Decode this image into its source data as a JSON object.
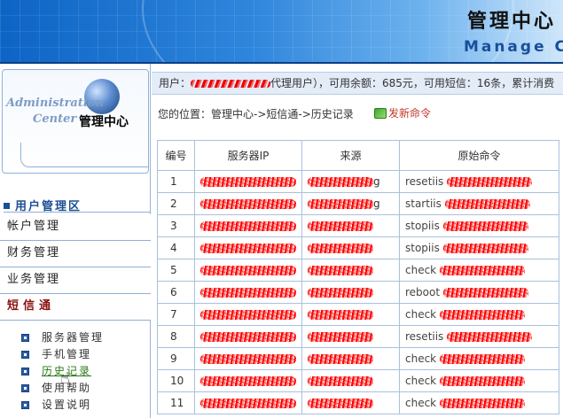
{
  "banner": {
    "title_cn": "管理中心",
    "title_en": "Manage C"
  },
  "logo": {
    "admin_text": "Administration",
    "center_text": "Center",
    "title_cn": "管理中心",
    "globe_icon": "globe-icon"
  },
  "sidebar": {
    "section_title": "用户管理区",
    "menu": [
      {
        "label": "帐户管理"
      },
      {
        "label": "财务管理"
      },
      {
        "label": "业务管理"
      },
      {
        "label": "短信通"
      }
    ],
    "sub_items": [
      {
        "label": "服务器管理"
      },
      {
        "label": "手机管理"
      },
      {
        "label": "历史记录"
      },
      {
        "label": "使用帮助"
      },
      {
        "label": "设置说明"
      }
    ]
  },
  "userbar": {
    "prefix": "用户：",
    "user_suffix": "代理用户），可用余额：685元，可用短信：16条，累计消费"
  },
  "breadcrumb": {
    "text": "您的位置：管理中心->短信通->历史记录"
  },
  "actions": {
    "send_label": "发新命令"
  },
  "table": {
    "headers": [
      "编号",
      "服务器IP",
      "来源",
      "原始命令"
    ],
    "rows": [
      {
        "id": "1",
        "src_suffix": "g",
        "cmd": "resetiis"
      },
      {
        "id": "2",
        "src_suffix": "g",
        "cmd": "startiis"
      },
      {
        "id": "3",
        "src_suffix": "",
        "cmd": "stopiis"
      },
      {
        "id": "4",
        "src_suffix": "",
        "cmd": "stopiis"
      },
      {
        "id": "5",
        "src_suffix": "",
        "cmd": "check"
      },
      {
        "id": "6",
        "src_suffix": "",
        "cmd": "reboot"
      },
      {
        "id": "7",
        "src_suffix": "",
        "cmd": "check"
      },
      {
        "id": "8",
        "src_suffix": "",
        "cmd": "resetiis"
      },
      {
        "id": "9",
        "src_suffix": "",
        "cmd": "check"
      },
      {
        "id": "10",
        "src_suffix": "",
        "cmd": "check"
      },
      {
        "id": "11",
        "src_suffix": "",
        "cmd": "check"
      }
    ]
  },
  "colors": {
    "banner": "#0d64c5",
    "accent": "#1b4e94",
    "active_menu": "#8b1111",
    "redaction": "#ff0000"
  }
}
